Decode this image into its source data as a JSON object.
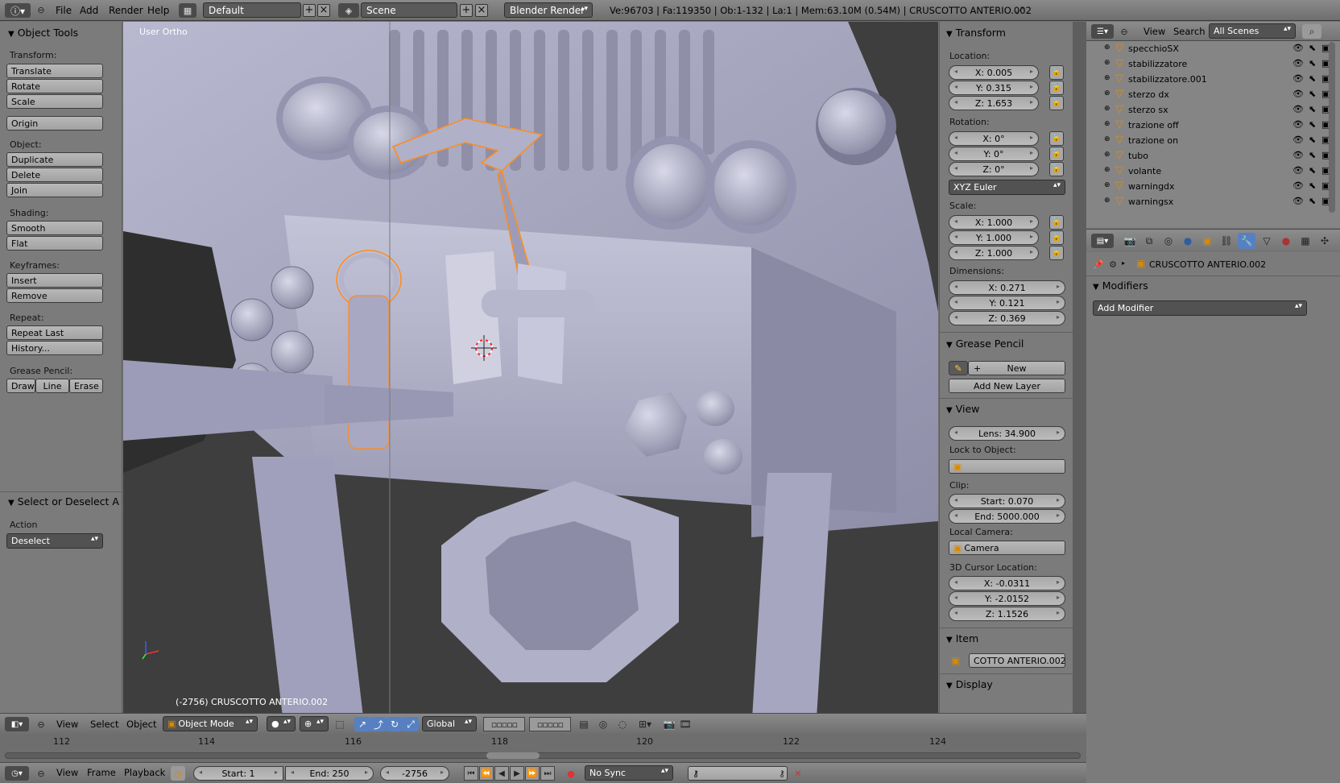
{
  "topbar": {
    "menus": [
      "File",
      "Add",
      "Render",
      "Help"
    ],
    "screen_layout": "Default",
    "scene": "Scene",
    "render_engine": "Blender Render",
    "stats": "Ve:96703 | Fa:119350 | Ob:1-132 | La:1 | Mem:63.10M (0.54M) | CRUSCOTTO ANTERIO.002"
  },
  "toolshelf": {
    "title": "Object Tools",
    "transform_label": "Transform:",
    "translate": "Translate",
    "rotate": "Rotate",
    "scale": "Scale",
    "origin": "Origin",
    "object_label": "Object:",
    "duplicate": "Duplicate",
    "delete": "Delete",
    "join": "Join",
    "shading_label": "Shading:",
    "smooth": "Smooth",
    "flat": "Flat",
    "keyframes_label": "Keyframes:",
    "insert": "Insert",
    "remove": "Remove",
    "repeat_label": "Repeat:",
    "repeat_last": "Repeat Last",
    "history": "History...",
    "grease_label": "Grease Pencil:",
    "draw": "Draw",
    "line": "Line",
    "erase": "Erase",
    "operator_title": "Select or Deselect A",
    "action_label": "Action",
    "action_value": "Deselect"
  },
  "viewport": {
    "view_name": "User Ortho",
    "status": "(-2756) CRUSCOTTO ANTERIO.002"
  },
  "npanel": {
    "transform_title": "Transform",
    "location_label": "Location:",
    "loc_x": "X: 0.005",
    "loc_y": "Y: 0.315",
    "loc_z": "Z: 1.653",
    "rotation_label": "Rotation:",
    "rot_x": "X: 0°",
    "rot_y": "Y: 0°",
    "rot_z": "Z: 0°",
    "rotation_mode": "XYZ Euler",
    "scale_label": "Scale:",
    "scale_x": "X: 1.000",
    "scale_y": "Y: 1.000",
    "scale_z": "Z: 1.000",
    "dimensions_label": "Dimensions:",
    "dim_x": "X: 0.271",
    "dim_y": "Y: 0.121",
    "dim_z": "Z: 0.369",
    "grease_title": "Grease Pencil",
    "gp_new": "New",
    "gp_add_layer": "Add New Layer",
    "view_title": "View",
    "lens": "Lens: 34.900",
    "lock_label": "Lock to Object:",
    "clip_label": "Clip:",
    "clip_start": "Start: 0.070",
    "clip_end": "End: 5000.000",
    "local_camera_label": "Local Camera:",
    "camera": "Camera",
    "cursor_label": "3D Cursor Location:",
    "cur_x": "X: -0.0311",
    "cur_y": "Y: -2.0152",
    "cur_z": "Z: 1.1526",
    "item_title": "Item",
    "item_name": "COTTO ANTERIO.002",
    "display_title": "Display"
  },
  "outliner": {
    "view": "View",
    "search": "Search",
    "scene_filter": "All Scenes",
    "rows": [
      {
        "name": "specchioSX"
      },
      {
        "name": "stabilizzatore"
      },
      {
        "name": "stabilizzatore.001"
      },
      {
        "name": "sterzo  dx"
      },
      {
        "name": "sterzo sx"
      },
      {
        "name": "trazione off"
      },
      {
        "name": "trazione on"
      },
      {
        "name": "tubo"
      },
      {
        "name": "volante"
      },
      {
        "name": "warningdx"
      },
      {
        "name": "warningsx"
      }
    ]
  },
  "properties": {
    "object_name": "CRUSCOTTO ANTERIO.002",
    "modifiers_title": "Modifiers",
    "add_modifier": "Add Modifier"
  },
  "v3d_header": {
    "view": "View",
    "select": "Select",
    "object": "Object",
    "mode": "Object Mode",
    "orientation": "Global"
  },
  "timeline": {
    "ticks": [
      "112",
      "114",
      "116",
      "118",
      "120",
      "122",
      "124"
    ],
    "view": "View",
    "frame": "Frame",
    "playback": "Playback",
    "start": "Start: 1",
    "end": "End: 250",
    "current": "-2756",
    "sync": "No Sync"
  },
  "colors": {
    "selection_outline": "#ff8c1a",
    "active_tool": "#5680c2",
    "mesh_shade": "#a9a9c6"
  }
}
